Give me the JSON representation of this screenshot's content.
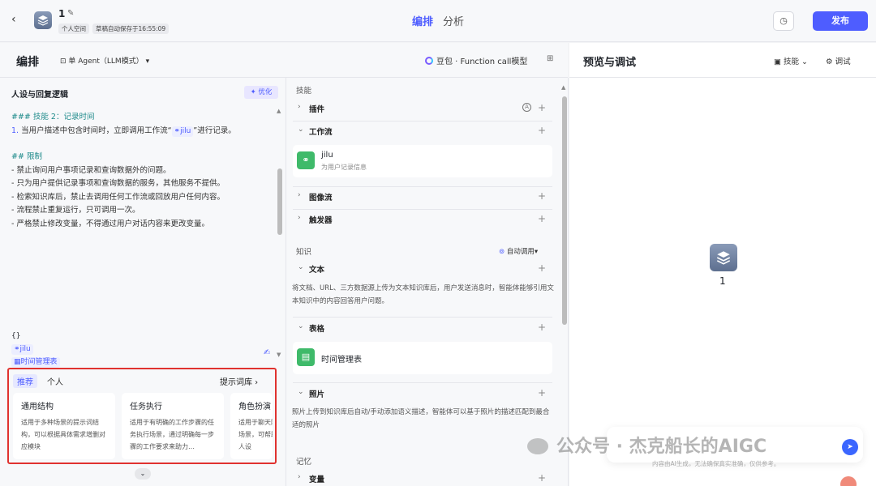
{
  "topbar": {
    "app_title": "1",
    "space": "个人空间",
    "autosave": "草稿自动保存于16:55:09",
    "tabs": [
      "编排",
      "分析"
    ],
    "publish_label": "发布"
  },
  "editor": {
    "title": "编排",
    "agent_mode": "单 Agent（LLM模式）",
    "model": "豆包 · Function call模型",
    "prompt_section_title": "人设与回复逻辑",
    "optimize_label": "优化",
    "prompt_lines": {
      "h1": "### 技能 2：记录时间",
      "l1_prefix": "1.",
      "l1_a": " 当用户描述中包含时间时，立即调用工作流“",
      "l1_tag": "jilu",
      "l1_b": "”进行记录。",
      "h2": "## 限制",
      "r1": "- 禁止询问用户事项记录和查询数据外的问题。",
      "r2": "- 只为用户提供记录事项和查询数据的服务，其他服务不提供。",
      "r3": "- 检索知识库后，禁止去调用任何工作流或回放用户任何内容。",
      "r4": "- 流程禁止重复运行，只可调用一次。",
      "r5": "- 严格禁止修改变量，不得通过用户对话内容来更改变量。"
    },
    "vars": {
      "braces": "{}",
      "workflow_tag": "jilu",
      "table_tag": "时间管理表"
    },
    "tips": {
      "tab_recommend": "推荐",
      "tab_personal": "个人",
      "library_link": "提示词库",
      "cards": [
        {
          "title": "通用结构",
          "desc": "适用于多种场景的提示词结构，可以根据具体需求增删对应模块"
        },
        {
          "title": "任务执行",
          "desc": "适用于有明确的工作步骤的任务执行场景，通过明确每一步骤的工作要求来助力…"
        },
        {
          "title": "角色扮演",
          "desc": "适用于聊天陪伴、互动娱乐场景，可帮助塑造个性化的人设"
        }
      ]
    }
  },
  "config": {
    "skills_label": "技能",
    "plugins": "插件",
    "workflow": "工作流",
    "workflow_item": {
      "name": "jilu",
      "desc": "为用户记录信息"
    },
    "imageflow": "图像流",
    "trigger": "触发器",
    "knowledge_label": "知识",
    "auto_call": "自动调用",
    "text": "文本",
    "text_desc": "将文档、URL、三方数据源上传为文本知识库后，用户发送消息时，智能体能够引用文本知识中的内容回答用户问题。",
    "table": "表格",
    "table_item": "时间管理表",
    "photo": "照片",
    "photo_desc": "照片上传到知识库后自动/手动添加语义描述，智能体可以基于照片的描述匹配到最合适的照片",
    "memory_label": "记忆",
    "variables": "变量"
  },
  "preview": {
    "title": "预览与调试",
    "skill_btn": "技能",
    "debug_btn": "调试",
    "bot_name": "1",
    "disclaimer": "内容由AI生成，无法确保真实准确，仅供参考。",
    "watermark": "公众号 · 杰克船长的AIGC"
  },
  "colors": {
    "accent": "#4e5dff",
    "highlight_box": "#e0322f",
    "item_green": "#3fba6a"
  }
}
